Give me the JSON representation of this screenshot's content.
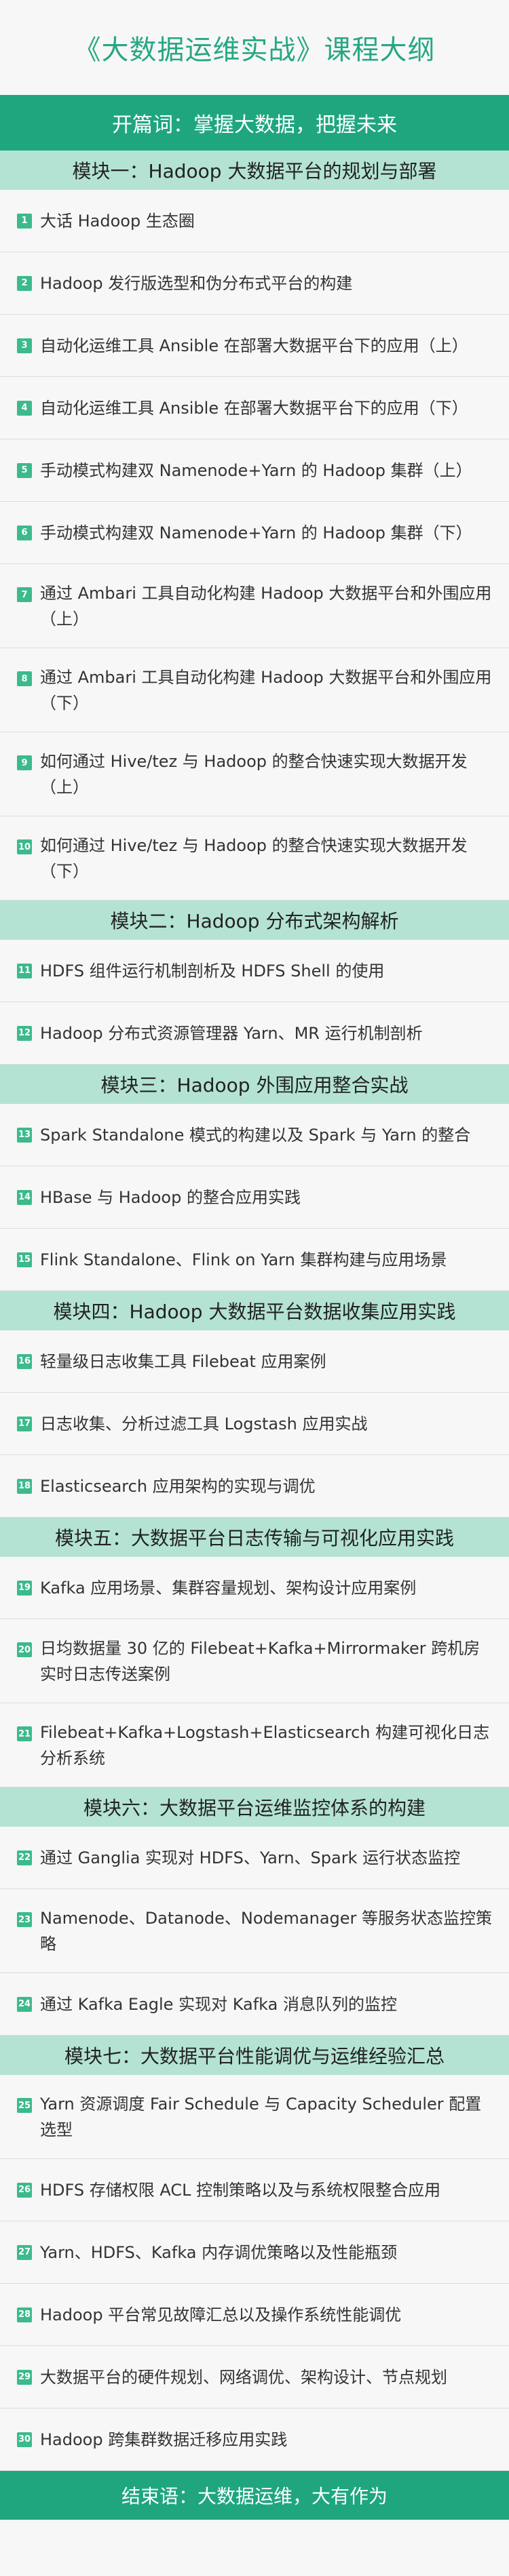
{
  "title": "《大数据运维实战》课程大纲",
  "opening": "开篇词：掌握大数据，把握未来",
  "closing": "结束语：大数据运维，大有作为",
  "modules": [
    {
      "title": "模块一：Hadoop 大数据平台的规划与部署",
      "lessons": [
        {
          "num": "1",
          "text": "大话 Hadoop 生态圈"
        },
        {
          "num": "2",
          "text": "Hadoop 发行版选型和伪分布式平台的构建"
        },
        {
          "num": "3",
          "text": "自动化运维工具 Ansible 在部署大数据平台下的应用（上）"
        },
        {
          "num": "4",
          "text": "自动化运维工具 Ansible 在部署大数据平台下的应用（下）"
        },
        {
          "num": "5",
          "text": "手动模式构建双 Namenode+Yarn 的 Hadoop 集群（上）"
        },
        {
          "num": "6",
          "text": "手动模式构建双 Namenode+Yarn 的 Hadoop 集群（下）"
        },
        {
          "num": "7",
          "text": "通过 Ambari 工具自动化构建 Hadoop 大数据平台和外围应用（上）"
        },
        {
          "num": "8",
          "text": "通过 Ambari 工具自动化构建 Hadoop 大数据平台和外围应用（下）"
        },
        {
          "num": "9",
          "text": "如何通过 Hive/tez 与 Hadoop 的整合快速实现大数据开发（上）"
        },
        {
          "num": "10",
          "text": "如何通过 Hive/tez 与 Hadoop 的整合快速实现大数据开发（下）"
        }
      ]
    },
    {
      "title": "模块二：Hadoop 分布式架构解析",
      "lessons": [
        {
          "num": "11",
          "text": "HDFS 组件运行机制剖析及 HDFS Shell 的使用"
        },
        {
          "num": "12",
          "text": "Hadoop 分布式资源管理器 Yarn、MR 运行机制剖析"
        }
      ]
    },
    {
      "title": "模块三：Hadoop 外围应用整合实战",
      "lessons": [
        {
          "num": "13",
          "text": "Spark Standalone 模式的构建以及 Spark 与 Yarn 的整合"
        },
        {
          "num": "14",
          "text": "HBase 与 Hadoop 的整合应用实践"
        },
        {
          "num": "15",
          "text": "Flink Standalone、Flink on Yarn 集群构建与应用场景"
        }
      ]
    },
    {
      "title": "模块四：Hadoop 大数据平台数据收集应用实践",
      "lessons": [
        {
          "num": "16",
          "text": "轻量级日志收集工具 Filebeat 应用案例"
        },
        {
          "num": "17",
          "text": "日志收集、分析过滤工具 Logstash 应用实战"
        },
        {
          "num": "18",
          "text": "Elasticsearch 应用架构的实现与调优"
        }
      ]
    },
    {
      "title": "模块五：大数据平台日志传输与可视化应用实践",
      "lessons": [
        {
          "num": "19",
          "text": "Kafka 应用场景、集群容量规划、架构设计应用案例"
        },
        {
          "num": "20",
          "text": "日均数据量 30 亿的 Filebeat+Kafka+Mirrormaker 跨机房实时日志传送案例"
        },
        {
          "num": "21",
          "text": "Filebeat+Kafka+Logstash+Elasticsearch 构建可视化日志分析系统"
        }
      ]
    },
    {
      "title": "模块六：大数据平台运维监控体系的构建",
      "lessons": [
        {
          "num": "22",
          "text": "通过 Ganglia 实现对 HDFS、Yarn、Spark 运行状态监控"
        },
        {
          "num": "23",
          "text": "Namenode、Datanode、Nodemanager 等服务状态监控策略"
        },
        {
          "num": "24",
          "text": "通过 Kafka Eagle 实现对 Kafka 消息队列的监控"
        }
      ]
    },
    {
      "title": "模块七：大数据平台性能调优与运维经验汇总",
      "lessons": [
        {
          "num": "25",
          "text": "Yarn 资源调度 Fair Schedule 与 Capacity Scheduler 配置选型"
        },
        {
          "num": "26",
          "text": "HDFS 存储权限 ACL 控制策略以及与系统权限整合应用"
        },
        {
          "num": "27",
          "text": "Yarn、HDFS、Kafka 内存调优策略以及性能瓶颈"
        },
        {
          "num": "28",
          "text": "Hadoop 平台常见故障汇总以及操作系统性能调优"
        },
        {
          "num": "29",
          "text": "大数据平台的硬件规划、网络调优、架构设计、节点规划"
        },
        {
          "num": "30",
          "text": "Hadoop 跨集群数据迁移应用实践"
        }
      ]
    }
  ]
}
